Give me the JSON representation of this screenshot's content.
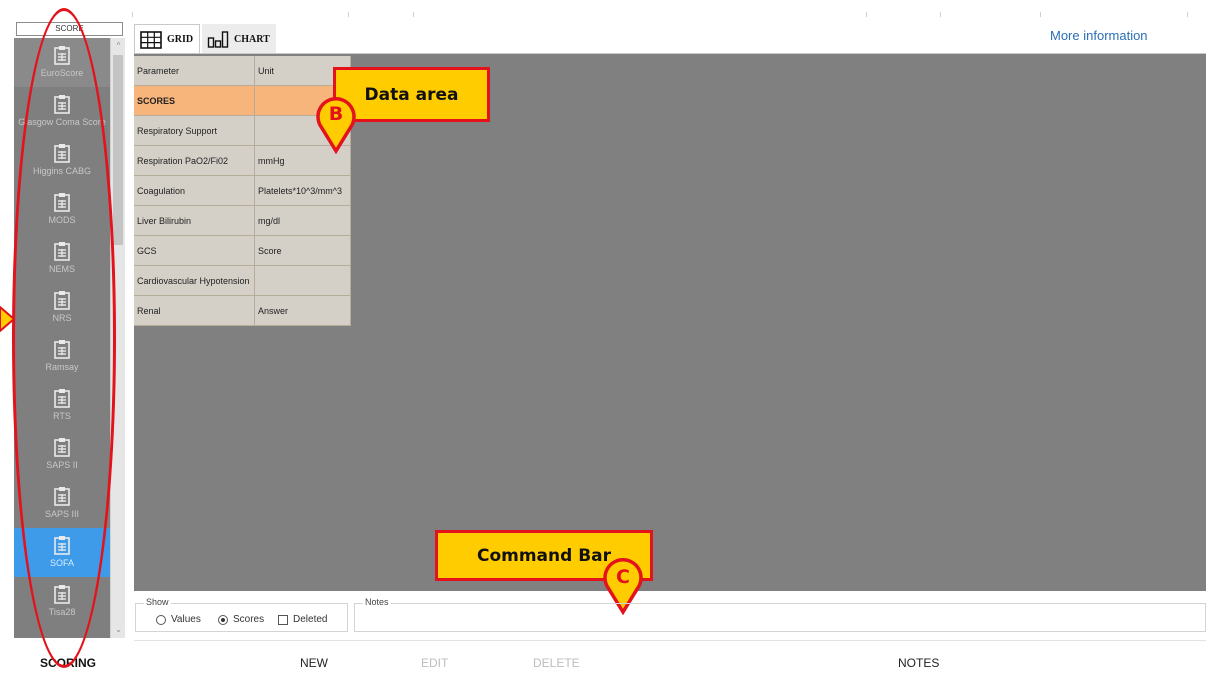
{
  "sidebar": {
    "header": "SCORE",
    "items": [
      {
        "label": "EuroScore"
      },
      {
        "label": "Glasgow Coma Score"
      },
      {
        "label": "Higgins CABG"
      },
      {
        "label": "MODS"
      },
      {
        "label": "NEMS"
      },
      {
        "label": "NRS"
      },
      {
        "label": "Ramsay"
      },
      {
        "label": "RTS"
      },
      {
        "label": "SAPS II"
      },
      {
        "label": "SAPS III"
      },
      {
        "label": "SOFA"
      },
      {
        "label": "Tisa28"
      }
    ]
  },
  "tabs": {
    "grid": "GRID",
    "chart": "CHART",
    "more_info": "More information"
  },
  "grid": {
    "headers": {
      "parameter": "Parameter",
      "unit": "Unit"
    },
    "rows": [
      {
        "parameter": "SCORES",
        "unit": ""
      },
      {
        "parameter": "Respiratory Support",
        "unit": ""
      },
      {
        "parameter": "Respiration PaO2/Fi02",
        "unit": "mmHg"
      },
      {
        "parameter": "Coagulation",
        "unit": "Platelets*10^3/mm^3"
      },
      {
        "parameter": "Liver Bilirubin",
        "unit": "mg/dl"
      },
      {
        "parameter": "GCS",
        "unit": "Score"
      },
      {
        "parameter": "Cardiovascular Hypotension",
        "unit": ""
      },
      {
        "parameter": "Renal",
        "unit": "Answer"
      }
    ]
  },
  "callouts": {
    "data_area": "Data area",
    "data_area_marker": "B",
    "command_bar": "Command Bar",
    "command_bar_marker": "C"
  },
  "show": {
    "legend": "Show",
    "values": "Values",
    "scores": "Scores",
    "deleted": "Deleted",
    "selected": "Scores"
  },
  "notes_legend": "Notes",
  "commands": {
    "scoring": "SCORING",
    "new": "NEW",
    "edit": "EDIT",
    "delete": "DELETE",
    "notes": "NOTES"
  },
  "colors": {
    "accent": "#3d9be9",
    "callout_fill": "#ffcc00",
    "callout_border": "#e3121b",
    "section_row": "#f7b47b",
    "data_area_bg": "#808080",
    "link": "#2a6fb5"
  }
}
